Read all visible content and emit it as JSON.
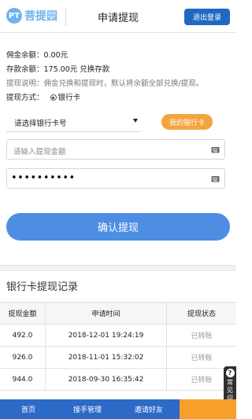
{
  "header": {
    "logo_badge": "PT",
    "logo_text": "菩提园",
    "title": "申请提现",
    "logout_label": "退出登录"
  },
  "info": {
    "commission_label": "佣金余额：",
    "commission_value": "0.00元",
    "deposit_label": "存款余额：",
    "deposit_value": "175.00元",
    "deposit_action": "兑换存款",
    "note_label": "提现说明：",
    "note_text": "佣金兑换和提现时，默认将余额全部兑换/提现。",
    "method_label": "提现方式：",
    "method_value": "银行卡"
  },
  "form": {
    "bank_select_value": "请选择银行卡号",
    "my_cards_label": "我的银行卡",
    "amount_placeholder": "请输入提现金额",
    "password_value": "••••••••••",
    "confirm_label": "确认提现"
  },
  "records": {
    "title": "银行卡提现记录",
    "columns": [
      "提现金额",
      "申请时间",
      "提现状态"
    ],
    "rows": [
      [
        "492.0",
        "2018-12-01 19:24:19",
        "已转账"
      ],
      [
        "926.0",
        "2018-11-01 15:32:02",
        "已转账"
      ],
      [
        "944.0",
        "2018-09-30 16:35:42",
        "已转账"
      ]
    ]
  },
  "help": {
    "icon": "?",
    "label": "常见问题"
  },
  "nav": {
    "items": [
      "首页",
      "接手管理",
      "邀请好友",
      ""
    ]
  },
  "colors": {
    "primary": "#1f69c3",
    "button_blue": "#4d8ee2",
    "accent_orange": "#f5a33d",
    "logo_blue": "#6fb3ec"
  }
}
